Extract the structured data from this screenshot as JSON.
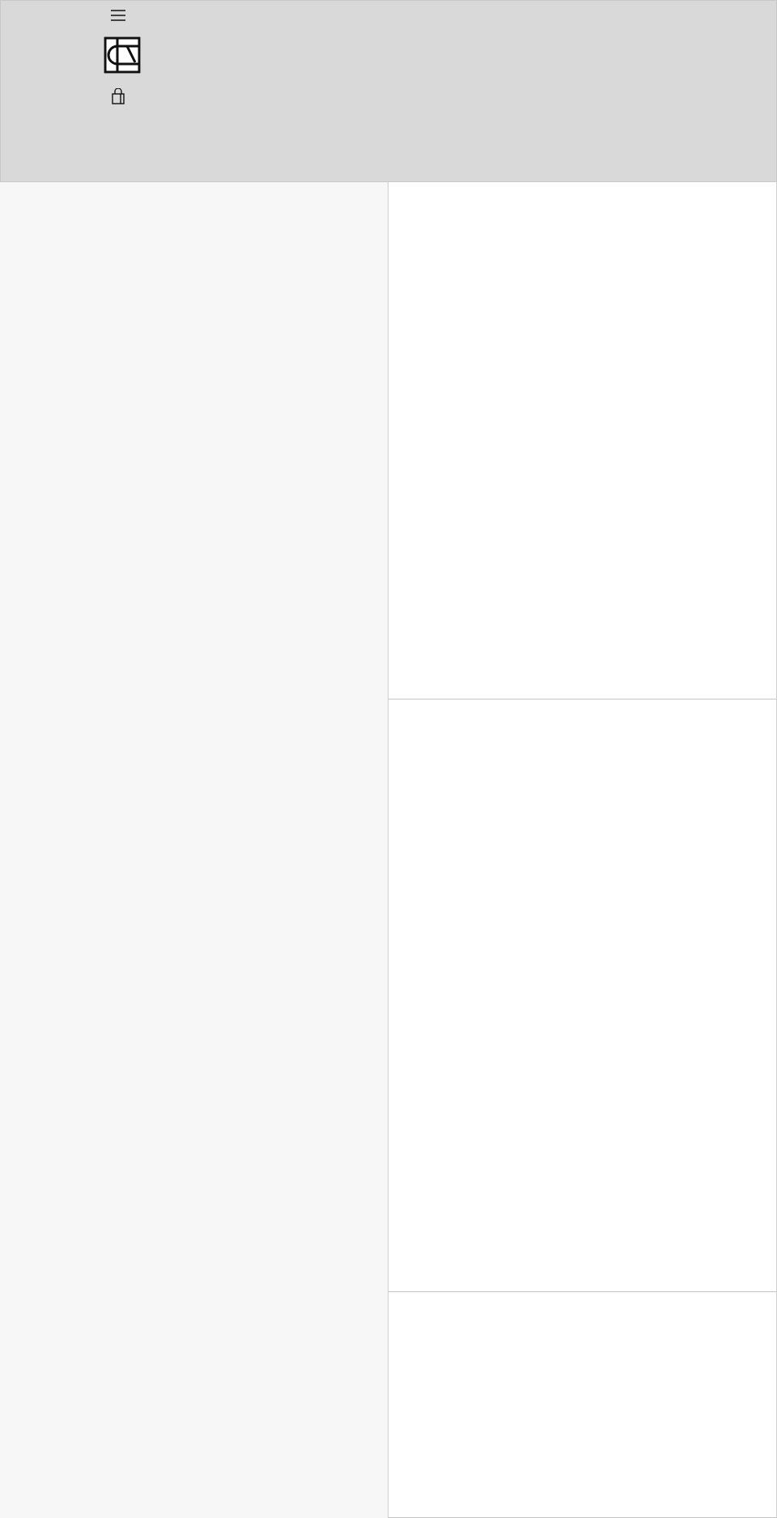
{
  "header": {
    "icons": [
      {
        "kind": "menu"
      },
      {
        "kind": "logo"
      },
      {
        "kind": "bag"
      }
    ]
  },
  "feature_panel": {
    "kind": "blank"
  },
  "tiles": [
    {
      "kind": "blank"
    },
    {
      "kind": "blank"
    },
    {
      "kind": "blank"
    }
  ]
}
